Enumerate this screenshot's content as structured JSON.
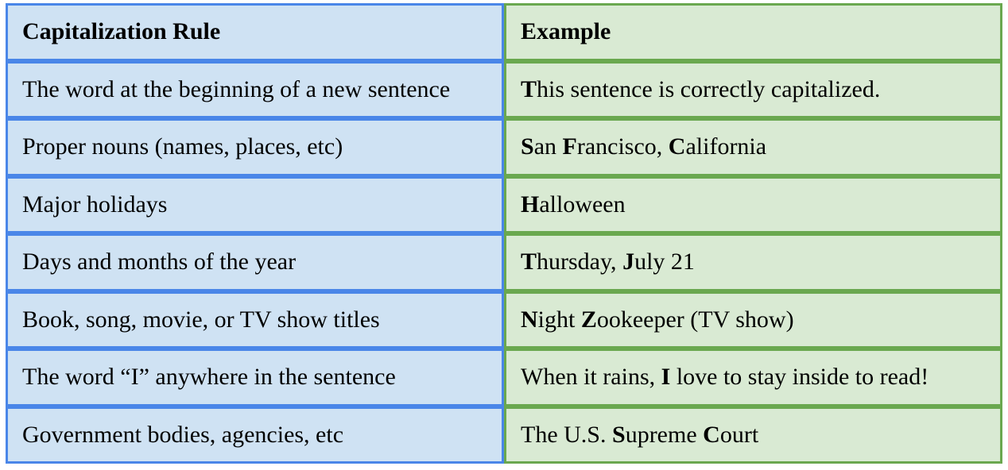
{
  "chart_data": {
    "type": "table",
    "columns": [
      "Capitalization Rule",
      "Example"
    ],
    "rows": [
      [
        "The word at the beginning of a new sentence",
        "This sentence is correctly capitalized."
      ],
      [
        "Proper nouns (names, places, etc)",
        "San Francisco, California"
      ],
      [
        "Major holidays",
        "Halloween"
      ],
      [
        "Days and months of the year",
        "Thursday, July 21"
      ],
      [
        "Book, song, movie, or TV show titles",
        "Night Zookeeper (TV show)"
      ],
      [
        "The word “I” anywhere in the sentence",
        "When it rains, I love to stay inside to read!"
      ],
      [
        "Government bodies, agencies, etc",
        "The U.S. Supreme Court"
      ]
    ]
  },
  "headers": {
    "rule": "Capitalization Rule",
    "example": "Example"
  },
  "rows": [
    {
      "rule": "The word at the beginning of a new sentence",
      "ex_pre": "",
      "ex_b1": "T",
      "ex_mid1": "his sentence is correctly capitalized.",
      "ex_b2": "",
      "ex_mid2": "",
      "ex_b3": "",
      "ex_tail": ""
    },
    {
      "rule": "Proper nouns (names, places, etc)",
      "ex_pre": "",
      "ex_b1": "S",
      "ex_mid1": "an ",
      "ex_b2": "F",
      "ex_mid2": "rancisco, ",
      "ex_b3": "C",
      "ex_tail": "alifornia"
    },
    {
      "rule": "Major holidays",
      "ex_pre": "",
      "ex_b1": "H",
      "ex_mid1": "alloween",
      "ex_b2": "",
      "ex_mid2": "",
      "ex_b3": "",
      "ex_tail": ""
    },
    {
      "rule": "Days and months of the year",
      "ex_pre": "",
      "ex_b1": "T",
      "ex_mid1": "hursday, ",
      "ex_b2": "J",
      "ex_mid2": "uly 21",
      "ex_b3": "",
      "ex_tail": ""
    },
    {
      "rule": "Book, song, movie, or TV show titles",
      "ex_pre": "",
      "ex_b1": "N",
      "ex_mid1": "ight ",
      "ex_b2": "Z",
      "ex_mid2": "ookeeper (TV show)",
      "ex_b3": "",
      "ex_tail": ""
    },
    {
      "rule": "The word “I” anywhere in the sentence",
      "ex_pre": "When it rains, ",
      "ex_b1": "I",
      "ex_mid1": " love to stay inside to read!",
      "ex_b2": "",
      "ex_mid2": "",
      "ex_b3": "",
      "ex_tail": ""
    },
    {
      "rule": "Government bodies, agencies, etc",
      "ex_pre": "The U.S. ",
      "ex_b1": "S",
      "ex_mid1": "upreme ",
      "ex_b2": "C",
      "ex_mid2": "ourt",
      "ex_b3": "",
      "ex_tail": ""
    }
  ]
}
